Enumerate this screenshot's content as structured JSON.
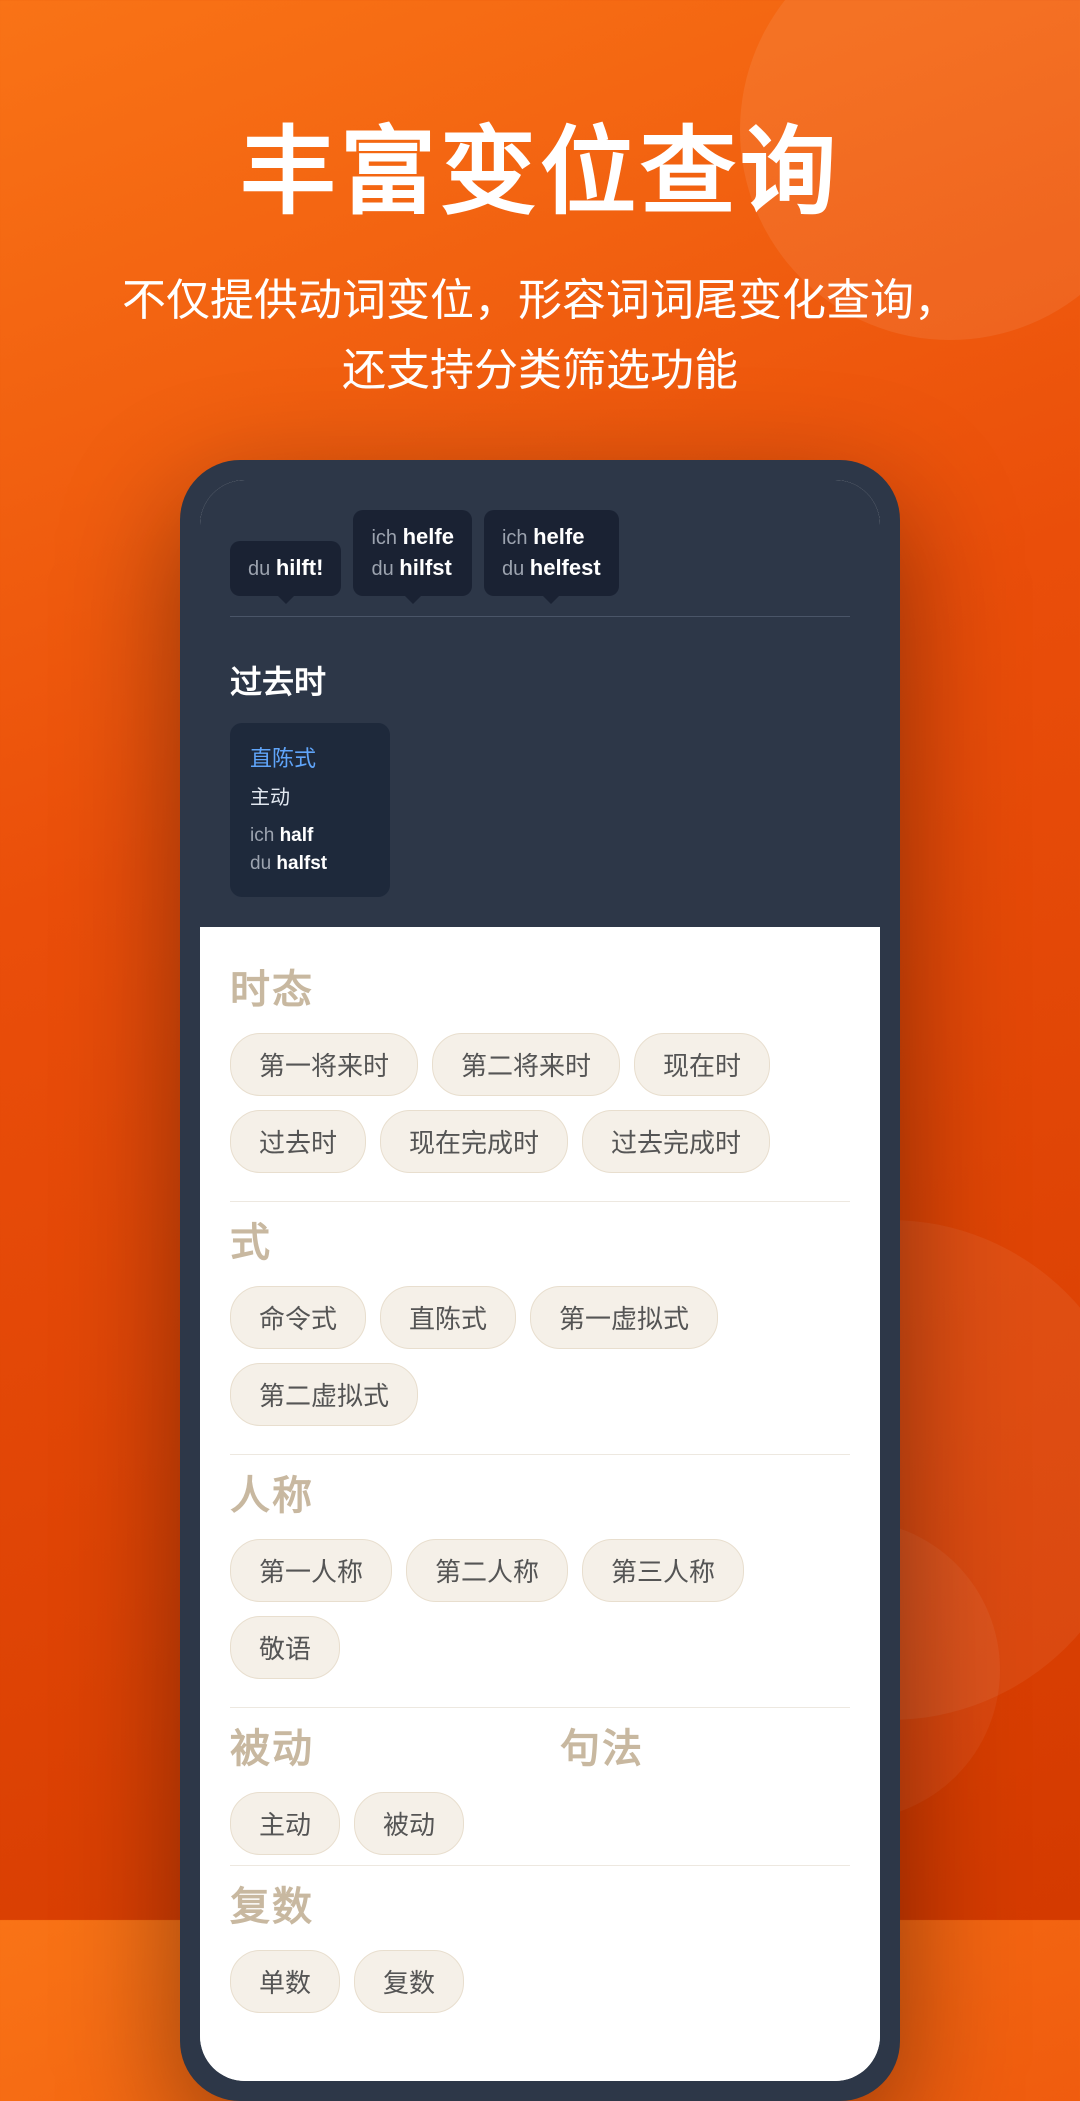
{
  "header": {
    "main_title": "丰富变位查询",
    "subtitle_line1": "不仅提供动词变位，形容词词尾变化查询，",
    "subtitle_line2": "还支持分类筛选功能"
  },
  "phone": {
    "tooltips": [
      {
        "pronoun": "du",
        "verb": "hilft",
        "id": "tooltip1"
      },
      {
        "pronoun": "ich",
        "verb": "helfe",
        "sub_pronoun": "du",
        "sub_verb": "hilfst",
        "id": "tooltip2"
      },
      {
        "pronoun": "ich",
        "verb": "helfe",
        "sub_pronoun": "du",
        "sub_verb": "helfest",
        "id": "tooltip3"
      }
    ],
    "tense_label": "过去时",
    "tense_card": {
      "mode": "直陈式",
      "voice": "主动",
      "line1_pronoun": "ich",
      "line1_verb": "half",
      "line2_pronoun": "du",
      "line2_verb": "halfst"
    },
    "filters": [
      {
        "id": "tense",
        "label": "时态",
        "tags": [
          "第一将来时",
          "第二将来时",
          "现在时",
          "过去时",
          "现在完成时",
          "过去完成时"
        ]
      },
      {
        "id": "mode",
        "label": "式",
        "tags": [
          "命令式",
          "直陈式",
          "第一虚拟式",
          "第二虚拟式"
        ]
      },
      {
        "id": "person",
        "label": "人称",
        "tags": [
          "第一人称",
          "第二人称",
          "第三人称",
          "敬语"
        ]
      },
      {
        "id": "voice",
        "label": "被动",
        "tags": [
          "主动",
          "被动"
        ],
        "label2": "句法",
        "tags2": []
      },
      {
        "id": "number",
        "label": "复数",
        "tags": [
          "单数",
          "复数"
        ]
      }
    ]
  }
}
